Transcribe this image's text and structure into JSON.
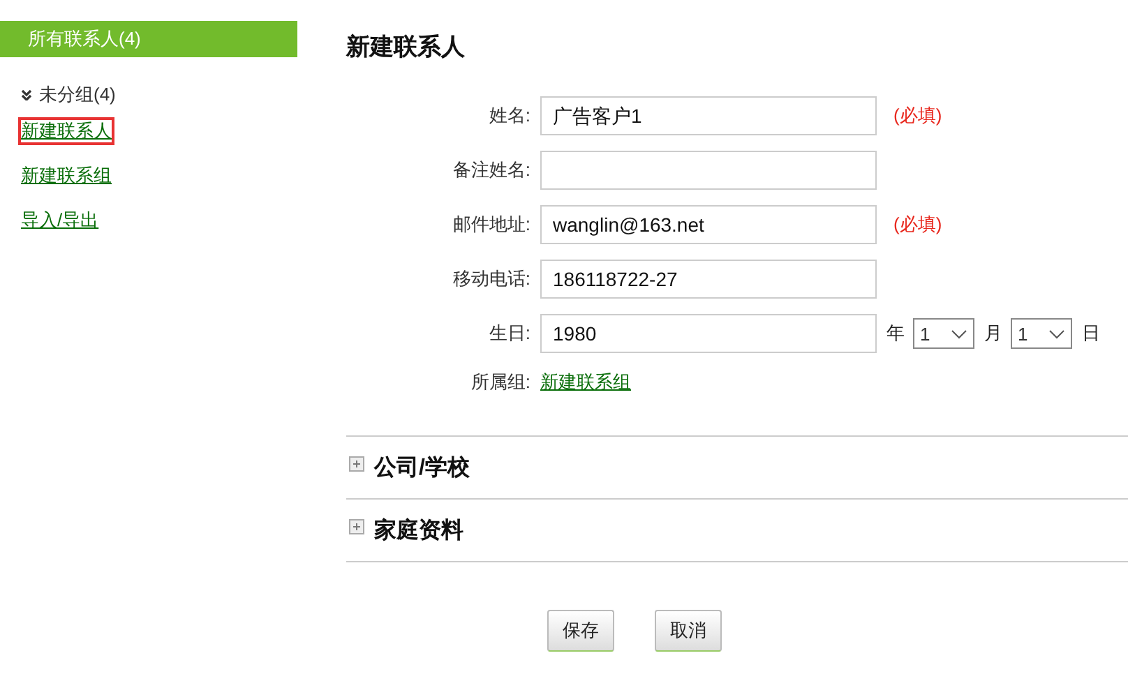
{
  "sidebar": {
    "header": "所有联系人(4)",
    "group": {
      "label": "未分组(4)",
      "expanded": true
    },
    "links": [
      {
        "label": "新建联系人",
        "selected": true
      },
      {
        "label": "新建联系组",
        "selected": false
      },
      {
        "label": "导入/导出",
        "selected": false
      }
    ]
  },
  "form": {
    "title": "新建联系人",
    "fields": [
      {
        "kind": "text",
        "label": "姓名:",
        "value": "广告客户1",
        "note": "(必填)"
      },
      {
        "kind": "text",
        "label": "备注姓名:"
      },
      {
        "kind": "text",
        "label": "邮件地址:",
        "value": "wanglin@163.net",
        "note": "(必填)"
      },
      {
        "kind": "text",
        "label": "移动电话:",
        "value": "186118722-27"
      },
      {
        "kind": "date",
        "label": "生日:",
        "value": "1980",
        "year_unit": "年",
        "month": "1",
        "month_unit": "月",
        "day": "1",
        "day_unit": "日"
      },
      {
        "kind": "link",
        "label": "所属组:",
        "value": "新建联系组"
      }
    ],
    "sections": [
      {
        "title": "公司/学校",
        "expanded": false
      },
      {
        "title": "家庭资料",
        "expanded": false
      }
    ],
    "buttons": [
      "保存",
      "取消"
    ]
  }
}
